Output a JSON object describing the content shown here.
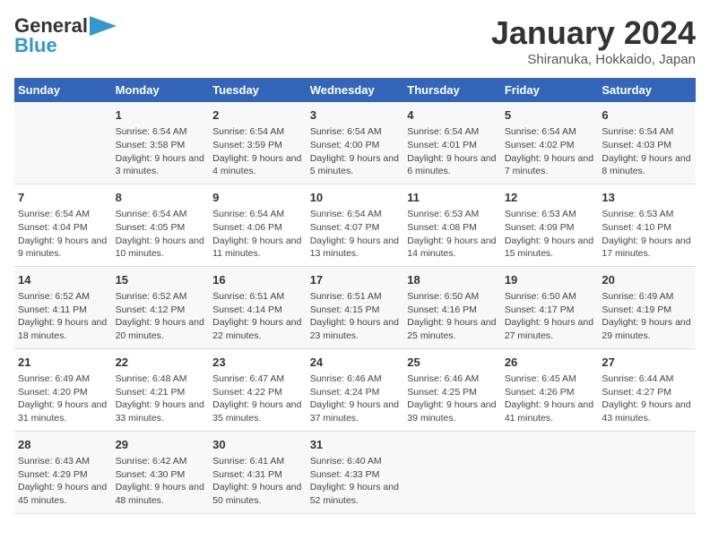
{
  "header": {
    "logo_line1": "General",
    "logo_line2": "Blue",
    "month_title": "January 2024",
    "subtitle": "Shiranuka, Hokkaido, Japan"
  },
  "days_of_week": [
    "Sunday",
    "Monday",
    "Tuesday",
    "Wednesday",
    "Thursday",
    "Friday",
    "Saturday"
  ],
  "weeks": [
    [
      {
        "day": "",
        "sunrise": "",
        "sunset": "",
        "daylight": ""
      },
      {
        "day": "1",
        "sunrise": "Sunrise: 6:54 AM",
        "sunset": "Sunset: 3:58 PM",
        "daylight": "Daylight: 9 hours and 3 minutes."
      },
      {
        "day": "2",
        "sunrise": "Sunrise: 6:54 AM",
        "sunset": "Sunset: 3:59 PM",
        "daylight": "Daylight: 9 hours and 4 minutes."
      },
      {
        "day": "3",
        "sunrise": "Sunrise: 6:54 AM",
        "sunset": "Sunset: 4:00 PM",
        "daylight": "Daylight: 9 hours and 5 minutes."
      },
      {
        "day": "4",
        "sunrise": "Sunrise: 6:54 AM",
        "sunset": "Sunset: 4:01 PM",
        "daylight": "Daylight: 9 hours and 6 minutes."
      },
      {
        "day": "5",
        "sunrise": "Sunrise: 6:54 AM",
        "sunset": "Sunset: 4:02 PM",
        "daylight": "Daylight: 9 hours and 7 minutes."
      },
      {
        "day": "6",
        "sunrise": "Sunrise: 6:54 AM",
        "sunset": "Sunset: 4:03 PM",
        "daylight": "Daylight: 9 hours and 8 minutes."
      }
    ],
    [
      {
        "day": "7",
        "sunrise": "Sunrise: 6:54 AM",
        "sunset": "Sunset: 4:04 PM",
        "daylight": "Daylight: 9 hours and 9 minutes."
      },
      {
        "day": "8",
        "sunrise": "Sunrise: 6:54 AM",
        "sunset": "Sunset: 4:05 PM",
        "daylight": "Daylight: 9 hours and 10 minutes."
      },
      {
        "day": "9",
        "sunrise": "Sunrise: 6:54 AM",
        "sunset": "Sunset: 4:06 PM",
        "daylight": "Daylight: 9 hours and 11 minutes."
      },
      {
        "day": "10",
        "sunrise": "Sunrise: 6:54 AM",
        "sunset": "Sunset: 4:07 PM",
        "daylight": "Daylight: 9 hours and 13 minutes."
      },
      {
        "day": "11",
        "sunrise": "Sunrise: 6:53 AM",
        "sunset": "Sunset: 4:08 PM",
        "daylight": "Daylight: 9 hours and 14 minutes."
      },
      {
        "day": "12",
        "sunrise": "Sunrise: 6:53 AM",
        "sunset": "Sunset: 4:09 PM",
        "daylight": "Daylight: 9 hours and 15 minutes."
      },
      {
        "day": "13",
        "sunrise": "Sunrise: 6:53 AM",
        "sunset": "Sunset: 4:10 PM",
        "daylight": "Daylight: 9 hours and 17 minutes."
      }
    ],
    [
      {
        "day": "14",
        "sunrise": "Sunrise: 6:52 AM",
        "sunset": "Sunset: 4:11 PM",
        "daylight": "Daylight: 9 hours and 18 minutes."
      },
      {
        "day": "15",
        "sunrise": "Sunrise: 6:52 AM",
        "sunset": "Sunset: 4:12 PM",
        "daylight": "Daylight: 9 hours and 20 minutes."
      },
      {
        "day": "16",
        "sunrise": "Sunrise: 6:51 AM",
        "sunset": "Sunset: 4:14 PM",
        "daylight": "Daylight: 9 hours and 22 minutes."
      },
      {
        "day": "17",
        "sunrise": "Sunrise: 6:51 AM",
        "sunset": "Sunset: 4:15 PM",
        "daylight": "Daylight: 9 hours and 23 minutes."
      },
      {
        "day": "18",
        "sunrise": "Sunrise: 6:50 AM",
        "sunset": "Sunset: 4:16 PM",
        "daylight": "Daylight: 9 hours and 25 minutes."
      },
      {
        "day": "19",
        "sunrise": "Sunrise: 6:50 AM",
        "sunset": "Sunset: 4:17 PM",
        "daylight": "Daylight: 9 hours and 27 minutes."
      },
      {
        "day": "20",
        "sunrise": "Sunrise: 6:49 AM",
        "sunset": "Sunset: 4:19 PM",
        "daylight": "Daylight: 9 hours and 29 minutes."
      }
    ],
    [
      {
        "day": "21",
        "sunrise": "Sunrise: 6:49 AM",
        "sunset": "Sunset: 4:20 PM",
        "daylight": "Daylight: 9 hours and 31 minutes."
      },
      {
        "day": "22",
        "sunrise": "Sunrise: 6:48 AM",
        "sunset": "Sunset: 4:21 PM",
        "daylight": "Daylight: 9 hours and 33 minutes."
      },
      {
        "day": "23",
        "sunrise": "Sunrise: 6:47 AM",
        "sunset": "Sunset: 4:22 PM",
        "daylight": "Daylight: 9 hours and 35 minutes."
      },
      {
        "day": "24",
        "sunrise": "Sunrise: 6:46 AM",
        "sunset": "Sunset: 4:24 PM",
        "daylight": "Daylight: 9 hours and 37 minutes."
      },
      {
        "day": "25",
        "sunrise": "Sunrise: 6:46 AM",
        "sunset": "Sunset: 4:25 PM",
        "daylight": "Daylight: 9 hours and 39 minutes."
      },
      {
        "day": "26",
        "sunrise": "Sunrise: 6:45 AM",
        "sunset": "Sunset: 4:26 PM",
        "daylight": "Daylight: 9 hours and 41 minutes."
      },
      {
        "day": "27",
        "sunrise": "Sunrise: 6:44 AM",
        "sunset": "Sunset: 4:27 PM",
        "daylight": "Daylight: 9 hours and 43 minutes."
      }
    ],
    [
      {
        "day": "28",
        "sunrise": "Sunrise: 6:43 AM",
        "sunset": "Sunset: 4:29 PM",
        "daylight": "Daylight: 9 hours and 45 minutes."
      },
      {
        "day": "29",
        "sunrise": "Sunrise: 6:42 AM",
        "sunset": "Sunset: 4:30 PM",
        "daylight": "Daylight: 9 hours and 48 minutes."
      },
      {
        "day": "30",
        "sunrise": "Sunrise: 6:41 AM",
        "sunset": "Sunset: 4:31 PM",
        "daylight": "Daylight: 9 hours and 50 minutes."
      },
      {
        "day": "31",
        "sunrise": "Sunrise: 6:40 AM",
        "sunset": "Sunset: 4:33 PM",
        "daylight": "Daylight: 9 hours and 52 minutes."
      },
      {
        "day": "",
        "sunrise": "",
        "sunset": "",
        "daylight": ""
      },
      {
        "day": "",
        "sunrise": "",
        "sunset": "",
        "daylight": ""
      },
      {
        "day": "",
        "sunrise": "",
        "sunset": "",
        "daylight": ""
      }
    ]
  ]
}
